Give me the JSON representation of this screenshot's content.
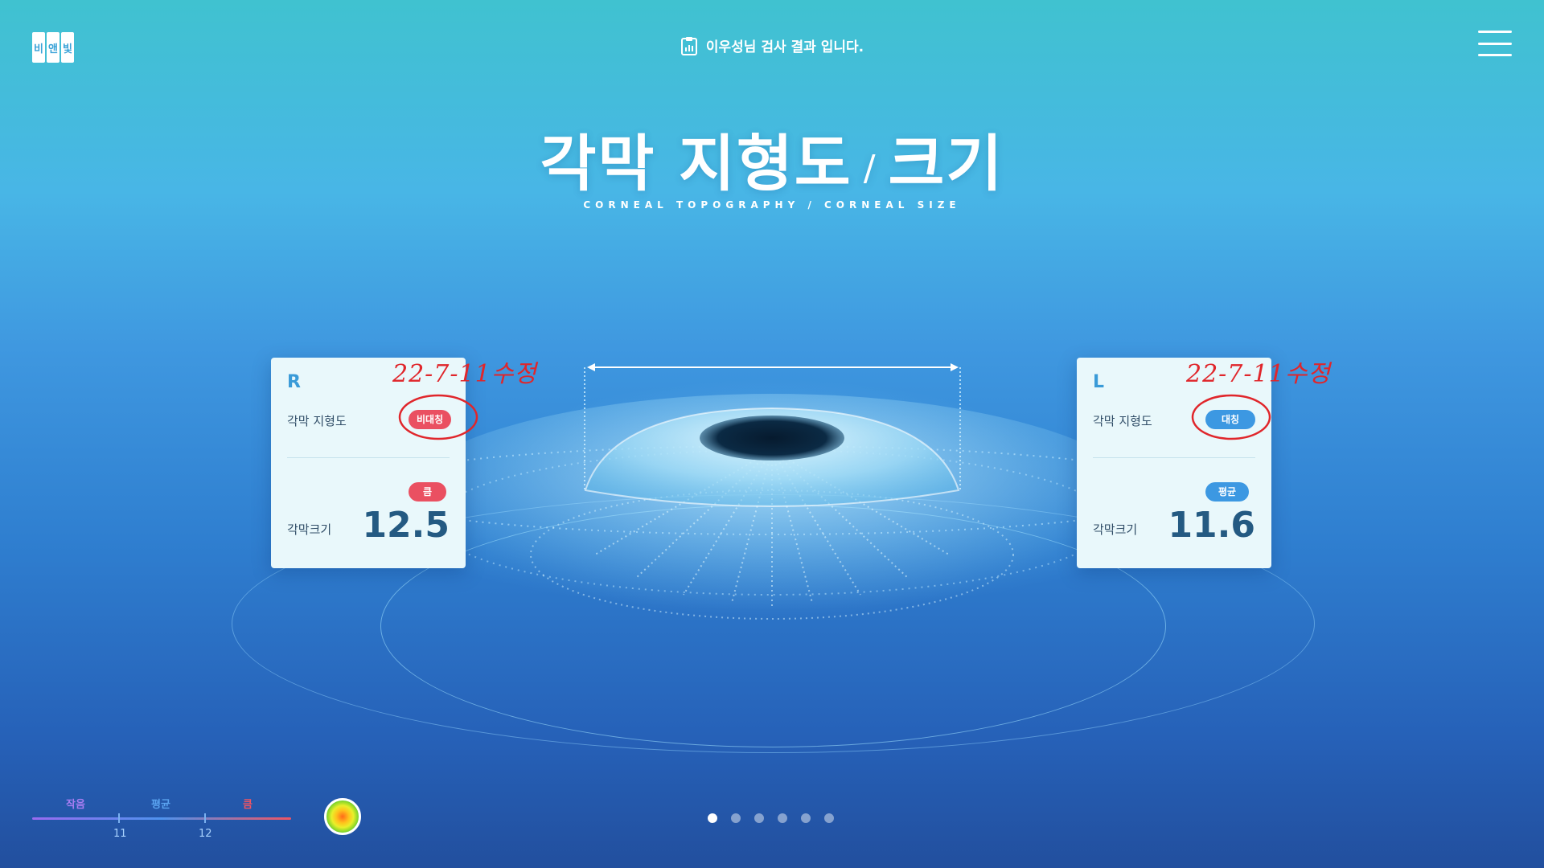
{
  "header": {
    "logo_chars": [
      "비",
      "앤",
      "빛"
    ],
    "result_title": "이우성님 검사 결과 입니다.",
    "result_icon": "clipboard-chart-icon",
    "menu_icon": "hamburger-menu-icon"
  },
  "page": {
    "title_left": "각막 지형도",
    "title_slash": "/",
    "title_right": "크기",
    "subtitle": "CORNEAL TOPOGRAPHY / CORNEAL SIZE"
  },
  "cards": {
    "right": {
      "side": "R",
      "topography_label": "각막 지형도",
      "topography_badge": "비대칭",
      "topography_badge_color": "#ea5061",
      "size_badge": "큼",
      "size_badge_color": "#ea5061",
      "size_label": "각막크기",
      "size_value": "12.5"
    },
    "left": {
      "side": "L",
      "topography_label": "각막 지형도",
      "topography_badge": "대칭",
      "topography_badge_color": "#3c98e2",
      "size_badge": "평균",
      "size_badge_color": "#3c98e2",
      "size_label": "각막크기",
      "size_value": "11.6"
    }
  },
  "annotations": {
    "right_note": "22-7-11수정",
    "left_note": "22-7-11수정",
    "color": "#e0262b"
  },
  "legend": {
    "labels": [
      "작음",
      "평균",
      "큼"
    ],
    "label_colors": [
      "#a77df2",
      "#5aa3f0",
      "#ef5563"
    ],
    "ticks": [
      "11",
      "12"
    ]
  },
  "heatmap_icon": "corneal-heatmap-icon",
  "pagination": {
    "total": 6,
    "active_index": 0
  }
}
